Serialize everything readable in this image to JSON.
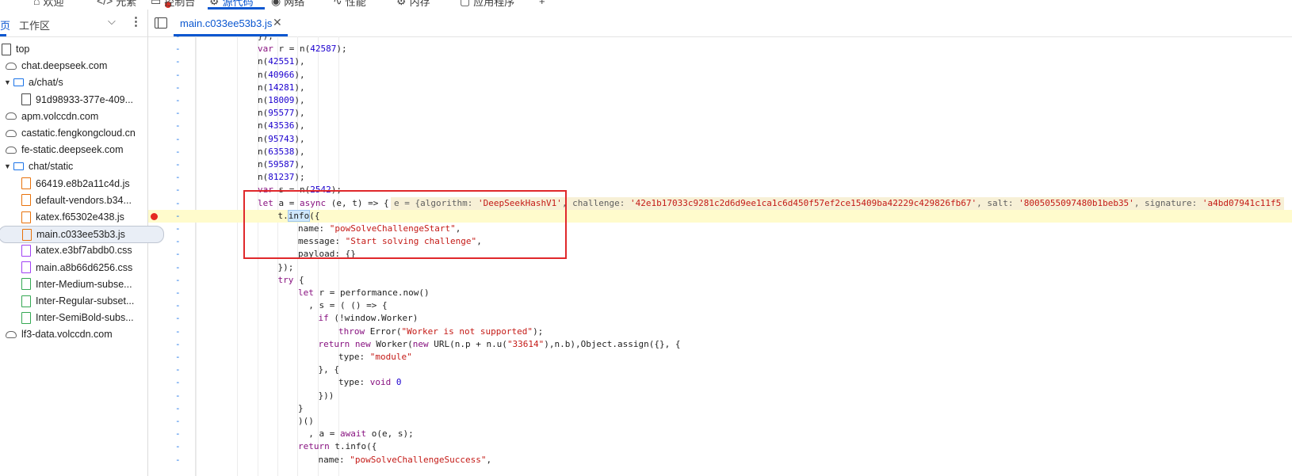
{
  "topbar": {
    "tabs": [
      {
        "label": "欢迎",
        "icon": "home-icon",
        "glyph": "⌂"
      },
      {
        "label": "元素",
        "icon": "elements-icon",
        "glyph": "</>"
      },
      {
        "label": "控制台",
        "icon": "console-icon",
        "glyph": "▭"
      },
      {
        "label": "源代码",
        "icon": "sources-icon",
        "glyph": "⚙"
      },
      {
        "label": "网络",
        "icon": "network-icon",
        "glyph": "◉"
      },
      {
        "label": "性能",
        "icon": "performance-icon",
        "glyph": "∿"
      },
      {
        "label": "内存",
        "icon": "memory-icon",
        "glyph": "⚙"
      },
      {
        "label": "应用程序",
        "icon": "application-icon",
        "glyph": "▢"
      }
    ],
    "add_glyph": "+"
  },
  "sidebar": {
    "page_tab": "页",
    "workspace_tab": "工作区",
    "tree": [
      {
        "label": "top",
        "type": "doc",
        "arrow": ""
      },
      {
        "label": "chat.deepseek.com",
        "type": "cloud",
        "arrow": ""
      },
      {
        "label": "a/chat/s",
        "type": "folder",
        "arrow": "▼"
      },
      {
        "label": "91d98933-377e-409...",
        "type": "doc",
        "arrow": ""
      },
      {
        "label": "apm.volccdn.com",
        "type": "cloud",
        "arrow": ""
      },
      {
        "label": "castatic.fengkongcloud.cn",
        "type": "cloud",
        "arrow": ""
      },
      {
        "label": "fe-static.deepseek.com",
        "type": "cloud",
        "arrow": ""
      },
      {
        "label": "chat/static",
        "type": "folder",
        "arrow": "▼"
      },
      {
        "label": "66419.e8b2a11c4d.js",
        "type": "js",
        "arrow": ""
      },
      {
        "label": "default-vendors.b34...",
        "type": "js",
        "arrow": ""
      },
      {
        "label": "katex.f65302e438.js",
        "type": "js",
        "arrow": ""
      },
      {
        "label": "main.c033ee53b3.js",
        "type": "js",
        "arrow": "",
        "selected": true
      },
      {
        "label": "katex.e3bf7abdb0.css",
        "type": "css",
        "arrow": ""
      },
      {
        "label": "main.a8b66d6256.css",
        "type": "css",
        "arrow": ""
      },
      {
        "label": "Inter-Medium-subse...",
        "type": "font",
        "arrow": ""
      },
      {
        "label": "Inter-Regular-subset...",
        "type": "font",
        "arrow": ""
      },
      {
        "label": "Inter-SemiBold-subs...",
        "type": "font",
        "arrow": ""
      },
      {
        "label": "lf3-data.volccdn.com",
        "type": "cloud",
        "arrow": ""
      }
    ]
  },
  "editor": {
    "file_tab": "main.c033ee53b3.js",
    "close_glyph": "✕",
    "gutter_marker": "-",
    "lines": [
      {
        "indent": 0,
        "html": "});"
      },
      {
        "indent": 0,
        "html": "<span class='kw'>var</span> r = n(<span class='num'>42587</span>);"
      },
      {
        "indent": 0,
        "html": "n(<span class='num'>42551</span>),"
      },
      {
        "indent": 0,
        "html": "n(<span class='num'>40966</span>),"
      },
      {
        "indent": 0,
        "html": "n(<span class='num'>14281</span>),"
      },
      {
        "indent": 0,
        "html": "n(<span class='num'>18009</span>),"
      },
      {
        "indent": 0,
        "html": "n(<span class='num'>95577</span>),"
      },
      {
        "indent": 0,
        "html": "n(<span class='num'>43536</span>),"
      },
      {
        "indent": 0,
        "html": "n(<span class='num'>95743</span>),"
      },
      {
        "indent": 0,
        "html": "n(<span class='num'>63538</span>),"
      },
      {
        "indent": 0,
        "html": "n(<span class='num'>59587</span>),"
      },
      {
        "indent": 0,
        "html": "n(<span class='num'>81237</span>);"
      },
      {
        "indent": 0,
        "html": "<span class='kw'>var</span> s = n(<span class='num'>2542</span>);"
      },
      {
        "indent": 0,
        "html": "<span class='kw'>let</span> a = <span class='kw'>async</span> (e, t) => {"
      },
      {
        "indent": 1,
        "html": "t.<span class='sel'>info</span>({",
        "paused": true,
        "breakpoint": true
      },
      {
        "indent": 2,
        "html": "name: <span class='str'>\"powSolveChallengeStart\"</span>,"
      },
      {
        "indent": 2,
        "html": "message: <span class='str'>\"Start solving challenge\"</span>,"
      },
      {
        "indent": 2,
        "html": "payload: {}"
      },
      {
        "indent": 1,
        "html": "});"
      },
      {
        "indent": 1,
        "html": "<span class='kw'>try</span> {"
      },
      {
        "indent": 2,
        "html": "<span class='kw'>let</span> r = performance.now()"
      },
      {
        "indent": 2,
        "html": "  , s = ( () => {"
      },
      {
        "indent": 3,
        "html": "<span class='kw'>if</span> (!window.Worker)"
      },
      {
        "indent": 4,
        "html": "<span class='kw'>throw</span> Error(<span class='str'>\"Worker is not supported\"</span>);"
      },
      {
        "indent": 3,
        "html": "<span class='kw'>return new</span> Worker(<span class='kw'>new</span> URL(n.p + n.u(<span class='str'>\"33614\"</span>),n.b),Object.assign({}, {"
      },
      {
        "indent": 4,
        "html": "type: <span class='str'>\"module\"</span>"
      },
      {
        "indent": 3,
        "html": "}, {"
      },
      {
        "indent": 4,
        "html": "type: <span class='kw'>void</span> <span class='num'>0</span>"
      },
      {
        "indent": 3,
        "html": "}))"
      },
      {
        "indent": 2,
        "html": "}"
      },
      {
        "indent": 2,
        "html": ")()"
      },
      {
        "indent": 2,
        "html": "  , a = <span class='kw'>await</span> o(e, s);"
      },
      {
        "indent": 2,
        "html": "<span class='kw'>return</span> t.info({"
      },
      {
        "indent": 3,
        "html": "name: <span class='str'>\"powSolveChallengeSuccess\"</span>,"
      }
    ],
    "inline_value": {
      "prefix": "e = {algorithm: ",
      "algorithm": "'DeepSeekHashV1'",
      "mid1": ", challenge: ",
      "challenge": "'42e1b17033c9281c2d6d9ee1ca1c6d450f57ef2ce15409ba42229c429826fb67'",
      "mid2": ", salt: ",
      "salt": "'8005055097480b1beb35'",
      "mid3": ", signature: ",
      "signature": "'a4bd07941c11f5"
    }
  }
}
